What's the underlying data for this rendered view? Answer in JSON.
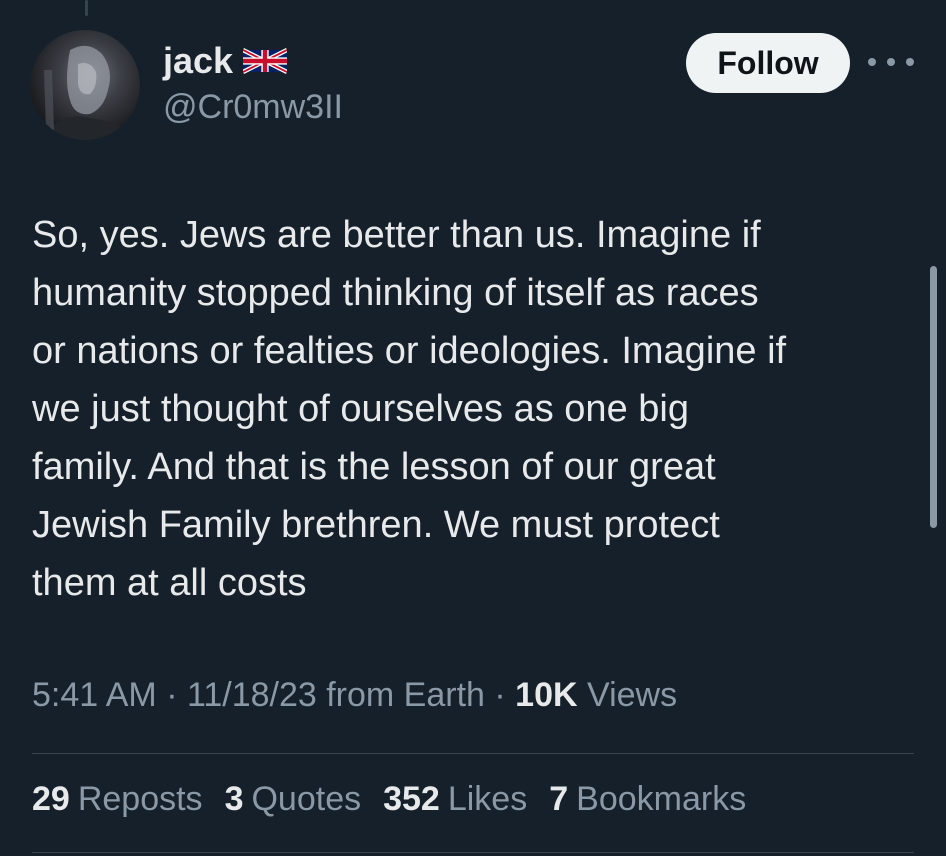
{
  "author": {
    "display_name": "jack",
    "handle": "@Cr0mw3II",
    "flag_icon": "uk-flag-icon"
  },
  "actions": {
    "follow_label": "Follow",
    "more_icon": "more-horizontal-icon"
  },
  "tweet": {
    "lines": [
      "So, yes. Jews are better than us. Imagine if",
      "humanity stopped thinking of itself as races",
      "or nations or fealties or ideologies. Imagine if",
      "we just thought of ourselves as one big",
      "family. And that is the lesson of our great",
      "Jewish Family brethren. We must protect",
      "them at all costs"
    ]
  },
  "meta": {
    "time_date": "5:41 AM · 11/18/23 from Earth ·",
    "views_count": "10K",
    "views_label": "Views"
  },
  "stats": {
    "reposts_count": "29",
    "reposts_label": "Reposts",
    "quotes_count": "3",
    "quotes_label": "Quotes",
    "likes_count": "352",
    "likes_label": "Likes",
    "bookmarks_count": "7",
    "bookmarks_label": "Bookmarks"
  },
  "colors": {
    "background": "#15202b",
    "text_primary": "#e7e9ea",
    "text_secondary": "#8b98a5",
    "follow_bg": "#eff3f4"
  }
}
